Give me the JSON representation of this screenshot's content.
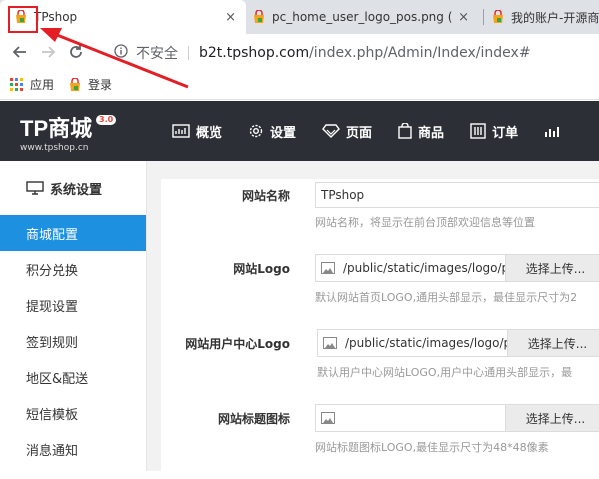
{
  "browser": {
    "tabs": [
      {
        "title": "TPshop",
        "active": true
      },
      {
        "title": "pc_home_user_logo_pos.png (",
        "active": false
      },
      {
        "title": "我的账户-开源商",
        "active": false
      }
    ],
    "tab_close_glyph": "×",
    "address": {
      "security_label": "不安全",
      "url_host": "b2t.tpshop.com",
      "url_path": "/index.php/Admin/Index/index#"
    },
    "bookmarks": [
      {
        "label": "应用"
      },
      {
        "label": "登录"
      }
    ]
  },
  "header": {
    "brand": "TP商城",
    "version": "3.0",
    "site": "www.tpshop.cn",
    "nav": [
      {
        "label": "概览",
        "icon": "chart-icon"
      },
      {
        "label": "设置",
        "icon": "gear-icon"
      },
      {
        "label": "页面",
        "icon": "diamond-icon"
      },
      {
        "label": "商品",
        "icon": "bag-icon"
      },
      {
        "label": "订单",
        "icon": "order-icon"
      }
    ]
  },
  "sidebar": {
    "title": "系统设置",
    "items": [
      {
        "label": "商城配置",
        "active": true
      },
      {
        "label": "积分兑换",
        "active": false
      },
      {
        "label": "提现设置",
        "active": false
      },
      {
        "label": "签到规则",
        "active": false
      },
      {
        "label": "地区&配送",
        "active": false
      },
      {
        "label": "短信模板",
        "active": false
      },
      {
        "label": "消息通知",
        "active": false
      }
    ]
  },
  "form": {
    "site_name": {
      "label": "网站名称",
      "value": "TPshop",
      "hint": "网站名称，将显示在前台顶部欢迎信息等位置"
    },
    "site_logo": {
      "label": "网站Logo",
      "path": "/public/static/images/logo/p",
      "button": "选择上传...",
      "hint": "默认网站首页LOGO,通用头部显示，最佳显示尺寸为2"
    },
    "user_logo": {
      "label": "网站用户中心Logo",
      "path": "/public/static/images/logo/p",
      "button": "选择上传...",
      "hint": "默认用户中心网站LOGO,用户中心通用头部显示，最"
    },
    "title_icon": {
      "label": "网站标题图标",
      "path": "",
      "button": "选择上传...",
      "hint": "网站标题图标LOGO,最佳显示尺寸为48*48像素"
    }
  },
  "colors": {
    "header_bg": "#2d2f37",
    "sidebar_active": "#1e90e0",
    "annotation": "#e31e24"
  }
}
